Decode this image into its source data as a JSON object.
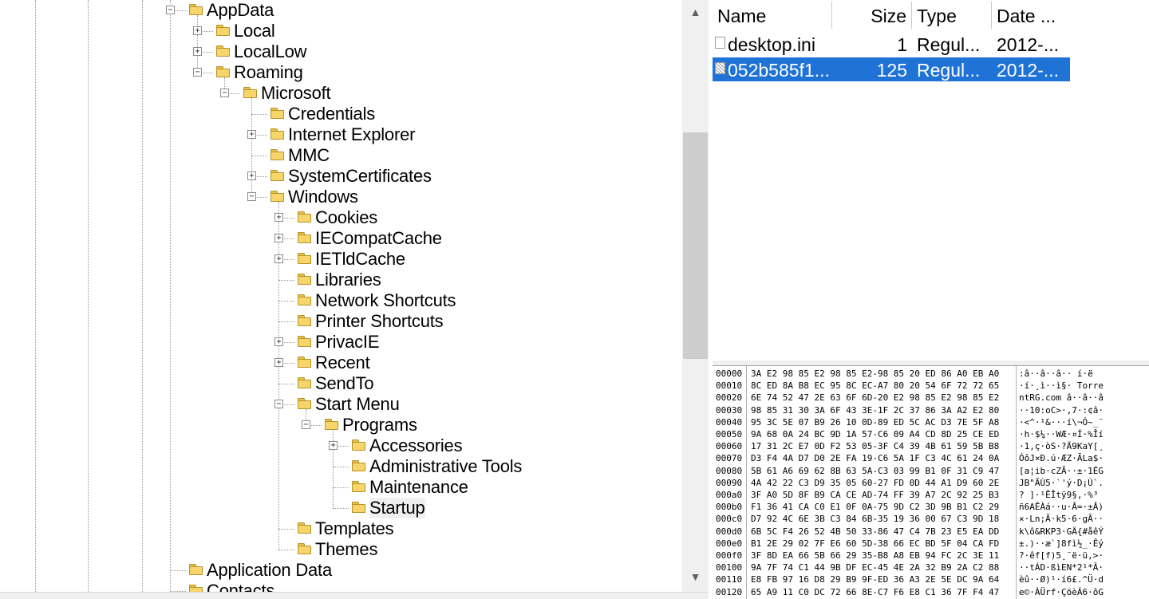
{
  "tree": {
    "nodes": [
      {
        "label": "AppData",
        "depth": 0,
        "expander": "minus"
      },
      {
        "label": "Local",
        "depth": 1,
        "expander": "plus"
      },
      {
        "label": "LocalLow",
        "depth": 1,
        "expander": "plus"
      },
      {
        "label": "Roaming",
        "depth": 1,
        "expander": "minus"
      },
      {
        "label": "Microsoft",
        "depth": 2,
        "expander": "minus"
      },
      {
        "label": "Credentials",
        "depth": 3,
        "expander": "none"
      },
      {
        "label": "Internet Explorer",
        "depth": 3,
        "expander": "plus"
      },
      {
        "label": "MMC",
        "depth": 3,
        "expander": "none"
      },
      {
        "label": "SystemCertificates",
        "depth": 3,
        "expander": "plus"
      },
      {
        "label": "Windows",
        "depth": 3,
        "expander": "minus"
      },
      {
        "label": "Cookies",
        "depth": 4,
        "expander": "plus"
      },
      {
        "label": "IECompatCache",
        "depth": 4,
        "expander": "plus"
      },
      {
        "label": "IETldCache",
        "depth": 4,
        "expander": "plus"
      },
      {
        "label": "Libraries",
        "depth": 4,
        "expander": "none"
      },
      {
        "label": "Network Shortcuts",
        "depth": 4,
        "expander": "none"
      },
      {
        "label": "Printer Shortcuts",
        "depth": 4,
        "expander": "none"
      },
      {
        "label": "PrivacIE",
        "depth": 4,
        "expander": "plus"
      },
      {
        "label": "Recent",
        "depth": 4,
        "expander": "plus"
      },
      {
        "label": "SendTo",
        "depth": 4,
        "expander": "none"
      },
      {
        "label": "Start Menu",
        "depth": 4,
        "expander": "minus"
      },
      {
        "label": "Programs",
        "depth": 5,
        "expander": "minus"
      },
      {
        "label": "Accessories",
        "depth": 6,
        "expander": "plus"
      },
      {
        "label": "Administrative Tools",
        "depth": 6,
        "expander": "none"
      },
      {
        "label": "Maintenance",
        "depth": 6,
        "expander": "none"
      },
      {
        "label": "Startup",
        "depth": 6,
        "expander": "none",
        "selected": true
      },
      {
        "label": "Templates",
        "depth": 4,
        "expander": "none"
      },
      {
        "label": "Themes",
        "depth": 4,
        "expander": "none"
      },
      {
        "label": "Application Data",
        "depth": 0,
        "expander": "none"
      },
      {
        "label": "Contacts",
        "depth": 0,
        "expander": "none"
      }
    ]
  },
  "scrollbar": {
    "up_arrow": "▲",
    "down_arrow": "▼"
  },
  "filelist": {
    "columns": [
      "Name",
      "Size",
      "Type",
      "Date ..."
    ],
    "rows": [
      {
        "name": "desktop.ini",
        "size": "1",
        "type": "Regul...",
        "date": "2012-...",
        "selected": false
      },
      {
        "name": "052b585f1...",
        "size": "125",
        "type": "Regul...",
        "date": "2012-...",
        "selected": true
      }
    ]
  },
  "colors": {
    "selection": "#1f73d6",
    "folder": "#f6d56a",
    "scrollbar_thumb": "#cdcdcd"
  },
  "hex": {
    "lines": [
      {
        "off": "00000",
        "bytes": "3A E2 98 85 E2 98 85 E2-98 85 20 ED 86 A0 EB A0",
        "ascii": ":â··â··â·· í·ë "
      },
      {
        "off": "00010",
        "bytes": "8C ED 8A B8 EC 95 8C EC-A7 80 20 54 6F 72 72 65",
        "ascii": "·í·¸ì··ì§· Torre"
      },
      {
        "off": "00020",
        "bytes": "6E 74 52 47 2E 63 6F 6D-20 E2 98 85 E2 98 85 E2",
        "ascii": "ntRG.com â··â··â"
      },
      {
        "off": "00030",
        "bytes": "98 85 31 30 3A 6F 43 3E-1F 2C 37 86 3A A2 E2 80",
        "ascii": "··10:oC>·,7·:¢â·"
      },
      {
        "off": "00040",
        "bytes": "95 3C 5E 07 B9 26 10 0D-89 ED 5C AC D3 7E 5F A8",
        "ascii": "·<^·¹&···í\\¬Ó~_¨"
      },
      {
        "off": "00050",
        "bytes": "9A 68 0A 24 BC 9D 1A 57-C6 09 A4 CD 8D 25 CE ED",
        "ascii": "·h·$¼··WÆ·¤Í·%Îí"
      },
      {
        "off": "00060",
        "bytes": "17 31 2C E7 0D F2 53 05-3F C4 39 4B 61 59 5B B8",
        "ascii": "·1,ç·òS·?Ä9KaY[¸"
      },
      {
        "off": "00070",
        "bytes": "D3 F4 4A D7 D0 2E FA 19-C6 5A 1F C3 4C 61 24 0A",
        "ascii": "ÓôJ×Ð.ú·ÆZ·ÃLa$·"
      },
      {
        "off": "00080",
        "bytes": "5B 61 A6 69 62 8B 63 5A-C3 03 99 B1 0F 31 C9 47",
        "ascii": "[a¦ib·cZÃ··±·1ÉG"
      },
      {
        "off": "00090",
        "bytes": "4A 42 22 C3 D9 35 05 60-27 FD 0D 44 A1 D9 60 2E",
        "ascii": "JB\"ÃÙ5·`'ý·D¡Ù`."
      },
      {
        "off": "000a0",
        "bytes": "3F A0 5D 8F B9 CA CE AD-74 FF 39 A7 2C 92 25 B3",
        "ascii": "? ]·¹ÊÎ­tÿ9§,·%³"
      },
      {
        "off": "000b0",
        "bytes": "F1 36 41 CA C0 E1 0F 0A-75 9D C2 3D 9B B1 C2 29",
        "ascii": "ñ6AÊÀá··u·Â=·±Â)"
      },
      {
        "off": "000c0",
        "bytes": "D7 92 4C 6E 3B C3 84 6B-35 19 36 00 67 C3 9D 18",
        "ascii": "×·Ln;Ã·k5·6·gÃ··"
      },
      {
        "off": "000d0",
        "bytes": "6B 5C F4 26 52 4B 50 33-86 47 C4 7B 23 E5 EA DD",
        "ascii": "k\\ô&RKP3·GÄ{#åêÝ"
      },
      {
        "off": "000e0",
        "bytes": "B1 2E 29 02 7F E6 60 5D-38 66 EC BD 5F 04 CA FD",
        "ascii": "±.)··æ`]8fì½_·Êý"
      },
      {
        "off": "000f0",
        "bytes": "3F 8D EA 66 5B 66 29 35-B8 A8 EB 94 FC 2C 3E 11",
        "ascii": "?·êf[f)5¸¨ë·ü,>·"
      },
      {
        "off": "00100",
        "bytes": "9A 7F 74 C1 44 9B DF EC-45 4E 2A 32 B9 2A C2 88",
        "ascii": "··tÁD·ßìEN*2¹*Â·"
      },
      {
        "off": "00110",
        "bytes": "E8 FB 97 16 D8 29 B9 9F-ED 36 A3 2E 5E DC 9A 64",
        "ascii": "èû··Ø)¹·í6£.^Ü·d"
      },
      {
        "off": "00120",
        "bytes": "65 A9 11 C0 DC 72 66 8E-C7 F6 E8 C1 36 7F F4 47",
        "ascii": "e©·ÀÜrf·ÇöèÁ6·ôG"
      }
    ]
  }
}
